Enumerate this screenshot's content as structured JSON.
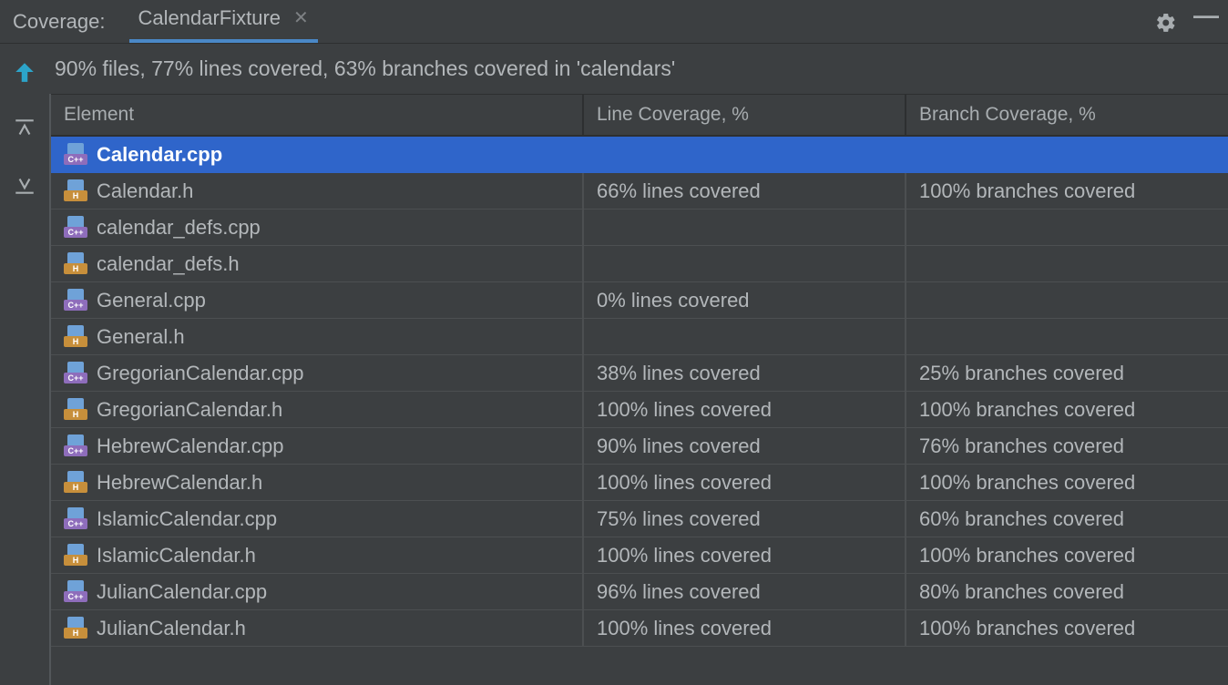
{
  "header": {
    "title": "Coverage:",
    "tab_label": "CalendarFixture"
  },
  "summary": "90% files, 77% lines covered, 63% branches covered in 'calendars'",
  "columns": {
    "element": "Element",
    "line": "Line Coverage, %",
    "branch": "Branch Coverage, %"
  },
  "rows": [
    {
      "icon": "cpp",
      "name": "Calendar.cpp",
      "line": "",
      "branch": "",
      "selected": true
    },
    {
      "icon": "h",
      "name": "Calendar.h",
      "line": "66% lines covered",
      "branch": "100% branches covered",
      "selected": false
    },
    {
      "icon": "cpp",
      "name": "calendar_defs.cpp",
      "line": "",
      "branch": "",
      "selected": false
    },
    {
      "icon": "h",
      "name": "calendar_defs.h",
      "line": "",
      "branch": "",
      "selected": false
    },
    {
      "icon": "cpp",
      "name": "General.cpp",
      "line": "0% lines covered",
      "branch": "",
      "selected": false
    },
    {
      "icon": "h",
      "name": "General.h",
      "line": "",
      "branch": "",
      "selected": false
    },
    {
      "icon": "cpp",
      "name": "GregorianCalendar.cpp",
      "line": "38% lines covered",
      "branch": "25% branches covered",
      "selected": false
    },
    {
      "icon": "h",
      "name": "GregorianCalendar.h",
      "line": "100% lines covered",
      "branch": "100% branches covered",
      "selected": false
    },
    {
      "icon": "cpp",
      "name": "HebrewCalendar.cpp",
      "line": "90% lines covered",
      "branch": "76% branches covered",
      "selected": false
    },
    {
      "icon": "h",
      "name": "HebrewCalendar.h",
      "line": "100% lines covered",
      "branch": "100% branches covered",
      "selected": false
    },
    {
      "icon": "cpp",
      "name": "IslamicCalendar.cpp",
      "line": "75% lines covered",
      "branch": "60% branches covered",
      "selected": false
    },
    {
      "icon": "h",
      "name": "IslamicCalendar.h",
      "line": "100% lines covered",
      "branch": "100% branches covered",
      "selected": false
    },
    {
      "icon": "cpp",
      "name": "JulianCalendar.cpp",
      "line": "96% lines covered",
      "branch": "80% branches covered",
      "selected": false
    },
    {
      "icon": "h",
      "name": "JulianCalendar.h",
      "line": "100% lines covered",
      "branch": "100% branches covered",
      "selected": false
    }
  ]
}
